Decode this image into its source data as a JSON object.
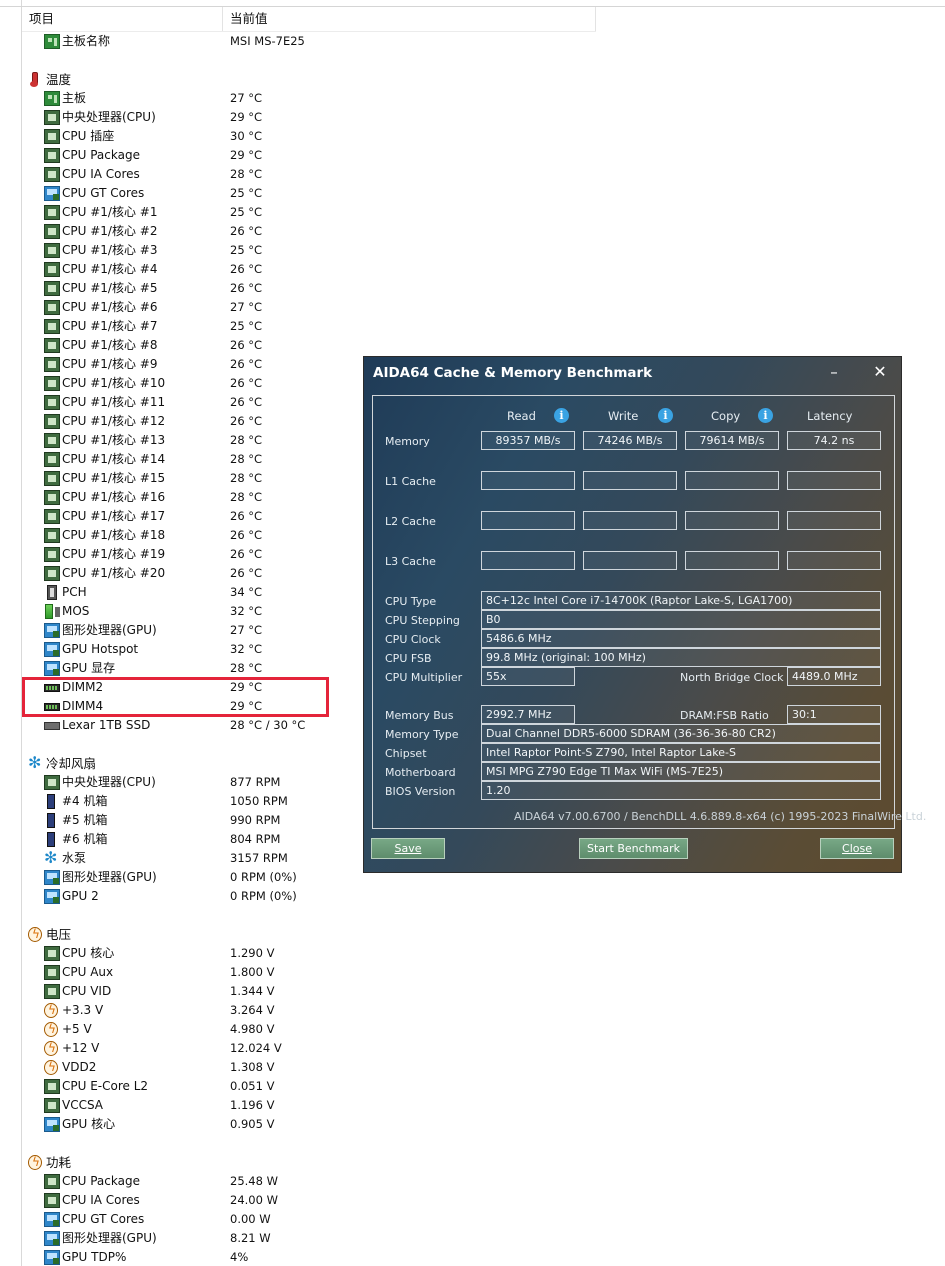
{
  "header": {
    "col_item": "项目",
    "col_value": "当前值"
  },
  "rows": [
    {
      "icon": "board",
      "label": "主板名称",
      "value": "MSI MS-7E25"
    },
    {
      "cat": true,
      "icon": "thermo",
      "label": "温度"
    },
    {
      "icon": "board",
      "label": "主板",
      "value": "27 °C"
    },
    {
      "icon": "chip",
      "label": "中央处理器(CPU)",
      "value": "29 °C"
    },
    {
      "icon": "chip",
      "label": "CPU 插座",
      "value": "30 °C"
    },
    {
      "icon": "chip",
      "label": "CPU Package",
      "value": "29 °C"
    },
    {
      "icon": "chip",
      "label": "CPU IA Cores",
      "value": "28 °C"
    },
    {
      "icon": "gpu",
      "label": "CPU GT Cores",
      "value": "25 °C"
    },
    {
      "icon": "chip",
      "label": "CPU #1/核心 #1",
      "value": "25 °C"
    },
    {
      "icon": "chip",
      "label": "CPU #1/核心 #2",
      "value": "26 °C"
    },
    {
      "icon": "chip",
      "label": "CPU #1/核心 #3",
      "value": "25 °C"
    },
    {
      "icon": "chip",
      "label": "CPU #1/核心 #4",
      "value": "26 °C"
    },
    {
      "icon": "chip",
      "label": "CPU #1/核心 #5",
      "value": "26 °C"
    },
    {
      "icon": "chip",
      "label": "CPU #1/核心 #6",
      "value": "27 °C"
    },
    {
      "icon": "chip",
      "label": "CPU #1/核心 #7",
      "value": "25 °C"
    },
    {
      "icon": "chip",
      "label": "CPU #1/核心 #8",
      "value": "26 °C"
    },
    {
      "icon": "chip",
      "label": "CPU #1/核心 #9",
      "value": "26 °C"
    },
    {
      "icon": "chip",
      "label": "CPU #1/核心 #10",
      "value": "26 °C"
    },
    {
      "icon": "chip",
      "label": "CPU #1/核心 #11",
      "value": "26 °C"
    },
    {
      "icon": "chip",
      "label": "CPU #1/核心 #12",
      "value": "26 °C"
    },
    {
      "icon": "chip",
      "label": "CPU #1/核心 #13",
      "value": "28 °C"
    },
    {
      "icon": "chip",
      "label": "CPU #1/核心 #14",
      "value": "28 °C"
    },
    {
      "icon": "chip",
      "label": "CPU #1/核心 #15",
      "value": "28 °C"
    },
    {
      "icon": "chip",
      "label": "CPU #1/核心 #16",
      "value": "28 °C"
    },
    {
      "icon": "chip",
      "label": "CPU #1/核心 #17",
      "value": "26 °C"
    },
    {
      "icon": "chip",
      "label": "CPU #1/核心 #18",
      "value": "26 °C"
    },
    {
      "icon": "chip",
      "label": "CPU #1/核心 #19",
      "value": "26 °C"
    },
    {
      "icon": "chip",
      "label": "CPU #1/核心 #20",
      "value": "26 °C"
    },
    {
      "icon": "pch",
      "label": "PCH",
      "value": "34 °C"
    },
    {
      "icon": "mos",
      "label": "MOS",
      "value": "32 °C"
    },
    {
      "icon": "gpu",
      "label": "图形处理器(GPU)",
      "value": "27 °C"
    },
    {
      "icon": "gpu",
      "label": "GPU Hotspot",
      "value": "32 °C"
    },
    {
      "icon": "gpu",
      "label": "GPU 显存",
      "value": "28 °C"
    },
    {
      "icon": "dimm",
      "label": "DIMM2",
      "value": "29 °C"
    },
    {
      "icon": "dimm",
      "label": "DIMM4",
      "value": "29 °C"
    },
    {
      "icon": "ssd",
      "label": "Lexar 1TB SSD",
      "value": "28 °C / 30 °C"
    },
    {
      "cat": true,
      "icon": "fan",
      "label": "冷却风扇"
    },
    {
      "icon": "chip",
      "label": "中央处理器(CPU)",
      "value": "877 RPM"
    },
    {
      "icon": "case",
      "label": "#4 机箱",
      "value": "1050 RPM"
    },
    {
      "icon": "case",
      "label": "#5 机箱",
      "value": "990 RPM"
    },
    {
      "icon": "case",
      "label": "#6 机箱",
      "value": "804 RPM"
    },
    {
      "icon": "fan",
      "label": "水泵",
      "value": "3157 RPM"
    },
    {
      "icon": "gpu",
      "label": "图形处理器(GPU)",
      "value": "0 RPM  (0%)"
    },
    {
      "icon": "gpu",
      "label": "GPU 2",
      "value": "0 RPM  (0%)"
    },
    {
      "cat": true,
      "icon": "bolt",
      "label": "电压"
    },
    {
      "icon": "chip",
      "label": "CPU 核心",
      "value": "1.290 V"
    },
    {
      "icon": "chip",
      "label": "CPU Aux",
      "value": "1.800 V"
    },
    {
      "icon": "chip",
      "label": "CPU VID",
      "value": "1.344 V"
    },
    {
      "icon": "bolt",
      "label": "+3.3 V",
      "value": "3.264 V"
    },
    {
      "icon": "bolt",
      "label": "+5 V",
      "value": "4.980 V"
    },
    {
      "icon": "bolt",
      "label": "+12 V",
      "value": "12.024 V"
    },
    {
      "icon": "bolt",
      "label": "VDD2",
      "value": "1.308 V"
    },
    {
      "icon": "chip",
      "label": "CPU E-Core L2",
      "value": "0.051 V"
    },
    {
      "icon": "chip",
      "label": "VCCSA",
      "value": "1.196 V"
    },
    {
      "icon": "gpu",
      "label": "GPU 核心",
      "value": "0.905 V"
    },
    {
      "cat": true,
      "icon": "bolt",
      "label": "功耗"
    },
    {
      "icon": "chip",
      "label": "CPU Package",
      "value": "25.48 W"
    },
    {
      "icon": "chip",
      "label": "CPU IA Cores",
      "value": "24.00 W"
    },
    {
      "icon": "gpu",
      "label": "CPU GT Cores",
      "value": "0.00 W"
    },
    {
      "icon": "gpu",
      "label": "图形处理器(GPU)",
      "value": "8.21 W"
    },
    {
      "icon": "gpu",
      "label": "GPU TDP%",
      "value": "4%"
    }
  ],
  "dialog": {
    "title": "AIDA64 Cache & Memory Benchmark",
    "minimize_glyph": "–",
    "close_glyph": "✕",
    "col_read": "Read",
    "col_write": "Write",
    "col_copy": "Copy",
    "col_latency": "Latency",
    "info_glyph": "i",
    "row_memory": "Memory",
    "row_l1": "L1 Cache",
    "row_l2": "L2 Cache",
    "row_l3": "L3 Cache",
    "memory_read": "89357 MB/s",
    "memory_write": "74246 MB/s",
    "memory_copy": "79614 MB/s",
    "memory_latency": "74.2 ns",
    "cpu_type_label": "CPU Type",
    "cpu_type": "8C+12c Intel Core i7-14700K  (Raptor Lake-S, LGA1700)",
    "cpu_stepping_label": "CPU Stepping",
    "cpu_stepping": "B0",
    "cpu_clock_label": "CPU Clock",
    "cpu_clock": "5486.6 MHz",
    "cpu_fsb_label": "CPU FSB",
    "cpu_fsb": "99.8 MHz  (original: 100 MHz)",
    "cpu_multiplier_label": "CPU Multiplier",
    "cpu_multiplier": "55x",
    "nb_clock_label": "North Bridge Clock",
    "nb_clock": "4489.0 MHz",
    "memory_bus_label": "Memory Bus",
    "memory_bus": "2992.7 MHz",
    "dram_fsb_label": "DRAM:FSB Ratio",
    "dram_fsb": "30:1",
    "memory_type_label": "Memory Type",
    "memory_type": "Dual Channel DDR5-6000 SDRAM  (36-36-36-80 CR2)",
    "chipset_label": "Chipset",
    "chipset": "Intel Raptor Point-S Z790, Intel Raptor Lake-S",
    "motherboard_label": "Motherboard",
    "motherboard": "MSI MPG Z790 Edge TI Max WiFi (MS-7E25)",
    "bios_label": "BIOS Version",
    "bios": "1.20",
    "footer": "AIDA64 v7.00.6700 / BenchDLL 4.6.889.8-x64  (c) 1995-2023 FinalWire Ltd.",
    "save_label": "Save",
    "start_label": "Start Benchmark",
    "close_label": "Close"
  }
}
